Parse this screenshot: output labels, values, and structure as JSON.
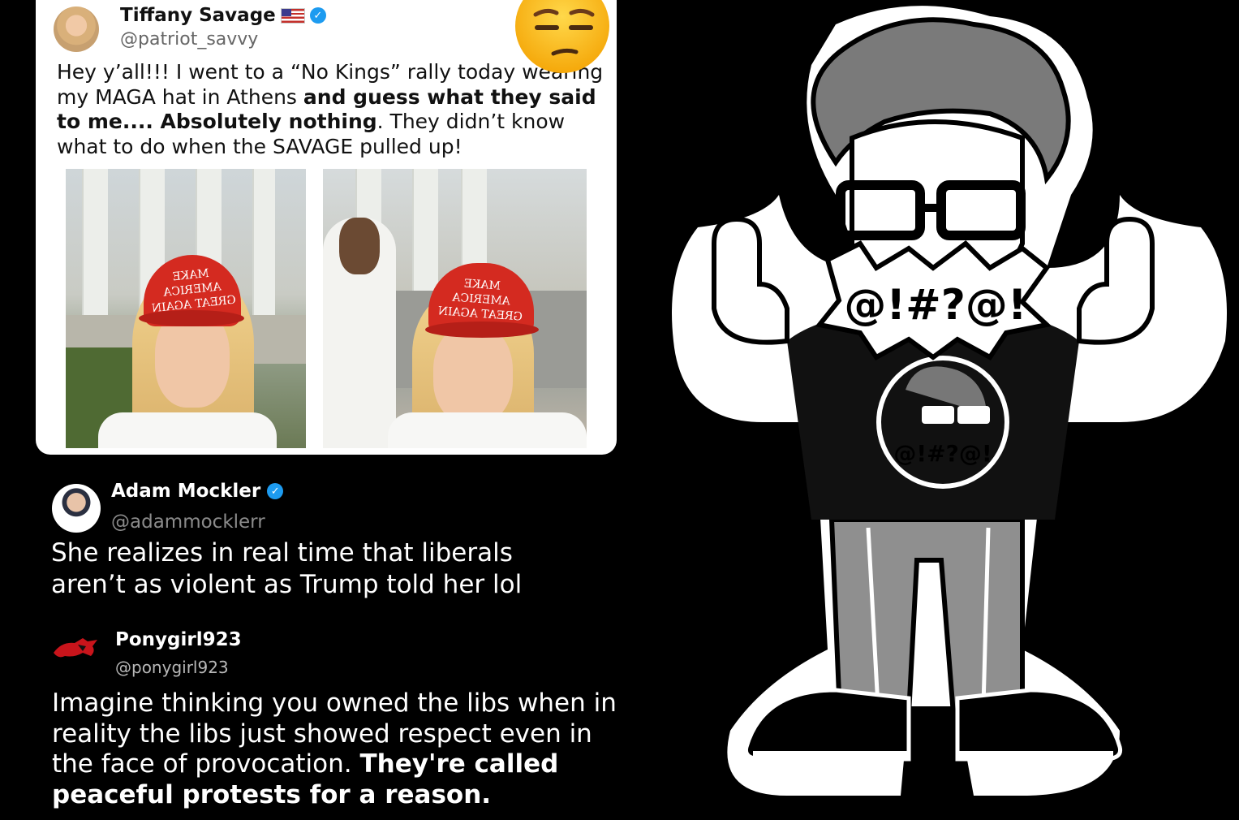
{
  "tweet_original": {
    "author_name": "Tiffany Savage",
    "author_handle": "@patriot_savvy",
    "text_1": "Hey y’all!!!  I went to a “No Kings” rally today wearing my MAGA hat in Athens ",
    "text_bold_1": "and guess what they said to me....  Absolutely nothing",
    "text_2": ".  They didn’t  know what to do when the SAVAGE pulled up!",
    "flag_icon": "us-flag-icon",
    "verified_icon": "verified-badge-icon",
    "reaction_emoji": "unamused-face-emoji",
    "photos": [
      {
        "hat_line_1": "MAKE AMERICA",
        "hat_line_2": "GREAT AGAIN"
      },
      {
        "hat_line_1": "MAKE AMERICA",
        "hat_line_2": "GREAT AGAIN"
      }
    ]
  },
  "reply_1": {
    "author_name": "Adam Mockler",
    "author_handle": "@adammocklerr",
    "text": "She realizes in real time that liberals aren’t as violent as Trump told her lol",
    "verified_icon": "verified-badge-icon"
  },
  "reply_2": {
    "author_name": "Ponygirl923",
    "author_handle": "@ponygirl923",
    "text_regular": "Imagine thinking you owned the libs when in reality the libs just showed respect even in the face of provocation. ",
    "text_bold": "They're called peaceful protests for a reason.",
    "avatar_icon": "mustang-logo-icon"
  },
  "mascot": {
    "speech_symbols": "@!#?@!",
    "shirt_symbols": "@!#?@!"
  },
  "colors": {
    "background": "#000000",
    "card": "#ffffff",
    "verified": "#1d9bf0",
    "hat_red": "#d42a20"
  }
}
